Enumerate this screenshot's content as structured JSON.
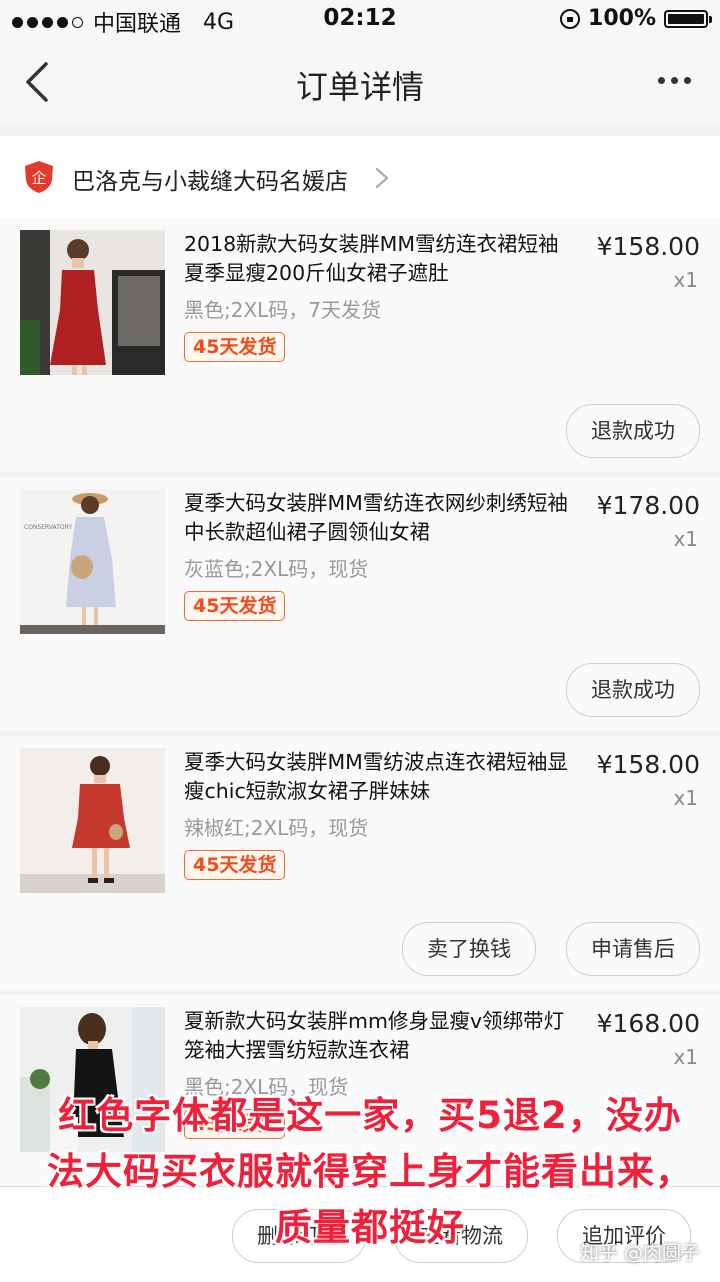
{
  "status_bar": {
    "carrier": "中国联通",
    "network": "4G",
    "time": "02:12",
    "battery": "100%"
  },
  "nav": {
    "title": "订单详情"
  },
  "shop": {
    "name": "巴洛克与小裁缝大码名媛店",
    "logo_text": "企"
  },
  "items": [
    {
      "name": "2018新款大码女装胖MM雪纺连衣裙短袖夏季显瘦200斤仙女裙子遮肚",
      "price": "¥158.00",
      "qty": "x1",
      "spec": "黑色;2XL码，7天发货",
      "tag": "45天发货",
      "buttons": [
        "退款成功"
      ]
    },
    {
      "name": "夏季大码女装胖MM雪纺连衣网纱刺绣短袖中长款超仙裙子圆领仙女裙",
      "price": "¥178.00",
      "qty": "x1",
      "spec": "灰蓝色;2XL码，现货",
      "tag": "45天发货",
      "thumb_text": "CONSERVATORY",
      "buttons": [
        "退款成功"
      ]
    },
    {
      "name": "夏季大码女装胖MM雪纺波点连衣裙短袖显瘦chic短款淑女裙子胖妹妹",
      "price": "¥158.00",
      "qty": "x1",
      "spec": "辣椒红;2XL码，现货",
      "tag": "45天发货",
      "buttons": [
        "卖了换钱",
        "申请售后"
      ]
    },
    {
      "name": "夏新款大码女装胖mm修身显瘦v领绑带灯笼袖大摆雪纺短款连衣裙",
      "price": "¥168.00",
      "qty": "x1",
      "spec": "黑色;2XL码，现货",
      "tag": "45天发货",
      "buttons": []
    }
  ],
  "bottom_actions": [
    "删除订单",
    "查看物流",
    "追加评价"
  ],
  "overlay_text": "红色字体都是这一家，买5退2，没办法大码买衣服就得穿上身才能看出来，质量都挺好",
  "watermark": "知乎 @肉圆子",
  "colors": {
    "tag_orange": "#ef4d1c",
    "overlay_red": "#f0203b",
    "shop_logo_red": "#e23b2e"
  }
}
